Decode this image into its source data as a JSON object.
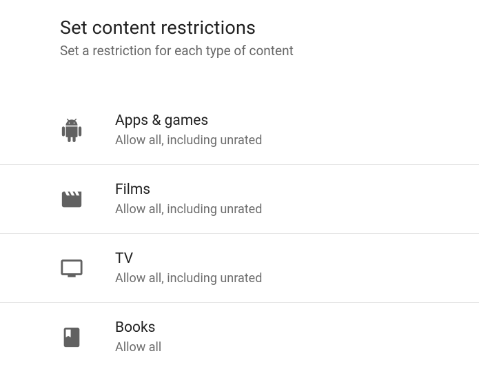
{
  "header": {
    "title": "Set content restrictions",
    "subtitle": "Set a restriction for each type of content"
  },
  "items": [
    {
      "title": "Apps & games",
      "subtitle": "Allow all, including unrated"
    },
    {
      "title": "Films",
      "subtitle": "Allow all, including unrated"
    },
    {
      "title": "TV",
      "subtitle": "Allow all, including unrated"
    },
    {
      "title": "Books",
      "subtitle": "Allow all"
    }
  ]
}
